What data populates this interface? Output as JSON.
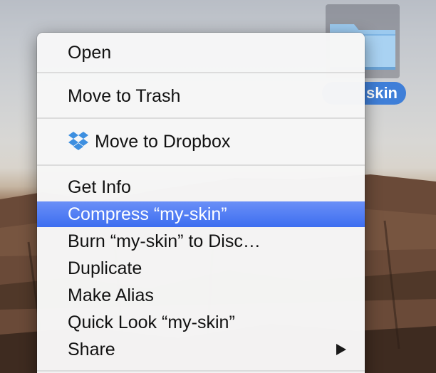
{
  "desktop": {
    "folder": {
      "icon": "folder-icon",
      "label": "skin"
    }
  },
  "menu": {
    "open": "Open",
    "move_to_trash": "Move to Trash",
    "move_to_dropbox": {
      "icon": "dropbox-icon",
      "label": "Move to Dropbox"
    },
    "get_info": "Get Info",
    "compress": "Compress “my-skin”",
    "burn": "Burn “my-skin” to Disc…",
    "duplicate": "Duplicate",
    "make_alias": "Make Alias",
    "quick_look": "Quick Look “my-skin”",
    "share": {
      "label": "Share",
      "icon": "submenu-arrow-icon"
    },
    "highlight_color": "#4a78f2"
  }
}
